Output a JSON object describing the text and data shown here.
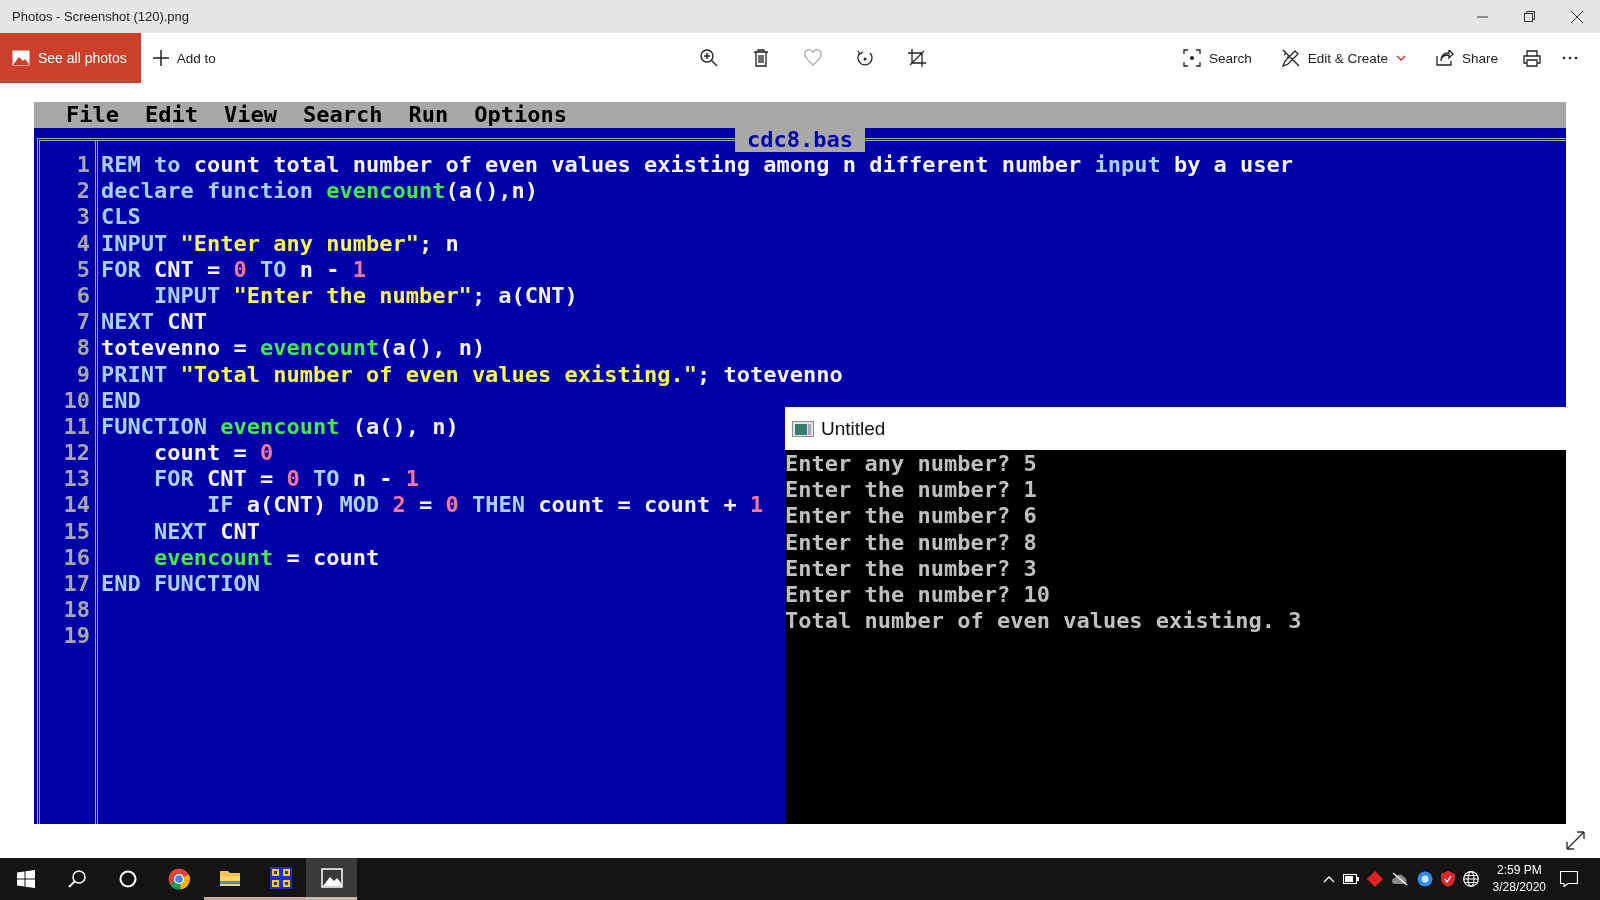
{
  "window": {
    "title": "Photos - Screenshot (120).png"
  },
  "toolbar": {
    "primary": "See all photos",
    "add": "Add to",
    "search": "Search",
    "edit": "Edit & Create",
    "share": "Share"
  },
  "editor": {
    "menu": [
      "File",
      "Edit",
      "View",
      "Search",
      "Run",
      "Options"
    ],
    "filename": "cdc8.bas",
    "lines": [
      {
        "number": "1",
        "tokens": [
          {
            "kind": "kw",
            "text": "REM to"
          },
          {
            "kind": "txt",
            "text": " count total number of even values existing among n different number "
          },
          {
            "kind": "kw",
            "text": "input"
          },
          {
            "kind": "txt",
            "text": " by a user"
          }
        ]
      },
      {
        "number": "2",
        "tokens": [
          {
            "kind": "kw",
            "text": "declare function "
          },
          {
            "kind": "fn",
            "text": "evencount"
          },
          {
            "kind": "txt",
            "text": "(a(),n)"
          }
        ]
      },
      {
        "number": "3",
        "tokens": [
          {
            "kind": "kw",
            "text": "CLS"
          }
        ]
      },
      {
        "number": "4",
        "tokens": [
          {
            "kind": "kw",
            "text": "INPUT "
          },
          {
            "kind": "str",
            "text": "\"Enter any number\""
          },
          {
            "kind": "txt",
            "text": "; n"
          }
        ]
      },
      {
        "number": "5",
        "tokens": [
          {
            "kind": "kw",
            "text": "FOR "
          },
          {
            "kind": "txt",
            "text": "CNT = "
          },
          {
            "kind": "num",
            "text": "0"
          },
          {
            "kind": "kw",
            "text": " TO "
          },
          {
            "kind": "txt",
            "text": "n - "
          },
          {
            "kind": "num",
            "text": "1"
          }
        ]
      },
      {
        "number": "6",
        "tokens": [
          {
            "kind": "kw",
            "text": "    INPUT "
          },
          {
            "kind": "str",
            "text": "\"Enter the number\""
          },
          {
            "kind": "txt",
            "text": "; a(CNT)"
          }
        ]
      },
      {
        "number": "7",
        "tokens": [
          {
            "kind": "kw",
            "text": "NEXT "
          },
          {
            "kind": "txt",
            "text": "CNT"
          }
        ]
      },
      {
        "number": "8",
        "tokens": [
          {
            "kind": "txt",
            "text": "totevenno = "
          },
          {
            "kind": "fn",
            "text": "evencount"
          },
          {
            "kind": "txt",
            "text": "(a(), n)"
          }
        ]
      },
      {
        "number": "9",
        "tokens": [
          {
            "kind": "kw",
            "text": "PRINT "
          },
          {
            "kind": "str",
            "text": "\"Total number of even values existing.\""
          },
          {
            "kind": "txt",
            "text": "; totevenno"
          }
        ]
      },
      {
        "number": "10",
        "tokens": [
          {
            "kind": "kw",
            "text": "END"
          }
        ]
      },
      {
        "number": "11",
        "tokens": [
          {
            "kind": "kw",
            "text": "FUNCTION "
          },
          {
            "kind": "fn",
            "text": "evencount"
          },
          {
            "kind": "txt",
            "text": " (a(), n)"
          }
        ]
      },
      {
        "number": "12",
        "tokens": [
          {
            "kind": "txt",
            "text": "    count = "
          },
          {
            "kind": "num",
            "text": "0"
          }
        ]
      },
      {
        "number": "13",
        "tokens": [
          {
            "kind": "kw",
            "text": "    FOR "
          },
          {
            "kind": "txt",
            "text": "CNT = "
          },
          {
            "kind": "num",
            "text": "0"
          },
          {
            "kind": "kw",
            "text": " TO "
          },
          {
            "kind": "txt",
            "text": "n - "
          },
          {
            "kind": "num",
            "text": "1"
          }
        ]
      },
      {
        "number": "14",
        "tokens": [
          {
            "kind": "kw",
            "text": "        IF "
          },
          {
            "kind": "txt",
            "text": "a(CNT) "
          },
          {
            "kind": "kw",
            "text": "MOD "
          },
          {
            "kind": "num",
            "text": "2"
          },
          {
            "kind": "txt",
            "text": " = "
          },
          {
            "kind": "num",
            "text": "0"
          },
          {
            "kind": "kw",
            "text": " THEN "
          },
          {
            "kind": "txt",
            "text": "count = count + "
          },
          {
            "kind": "num",
            "text": "1"
          }
        ]
      },
      {
        "number": "15",
        "tokens": [
          {
            "kind": "kw",
            "text": "    NEXT "
          },
          {
            "kind": "txt",
            "text": "CNT"
          }
        ]
      },
      {
        "number": "16",
        "tokens": [
          {
            "kind": "fn",
            "text": "    evencount"
          },
          {
            "kind": "txt",
            "text": " = count"
          }
        ]
      },
      {
        "number": "17",
        "tokens": [
          {
            "kind": "kw",
            "text": "END FUNCTION"
          }
        ]
      },
      {
        "number": "18"
      },
      {
        "number": "19"
      }
    ]
  },
  "output_window": {
    "title": "Untitled",
    "lines": [
      "Enter any number? 5",
      "Enter the number? 1",
      "Enter the number? 6",
      "Enter the number? 8",
      "Enter the number? 3",
      "Enter the number? 10",
      "Total number of even values existing. 3"
    ]
  },
  "taskbar": {
    "apps": [
      {
        "kind": "chrome",
        "running": false,
        "selected": false
      },
      {
        "kind": "folder",
        "running": true,
        "selected": false
      },
      {
        "kind": "qb64",
        "running": true,
        "selected": false
      },
      {
        "kind": "photos",
        "running": true,
        "selected": true
      }
    ],
    "time": "2:59 PM",
    "date": "3/28/2020"
  }
}
